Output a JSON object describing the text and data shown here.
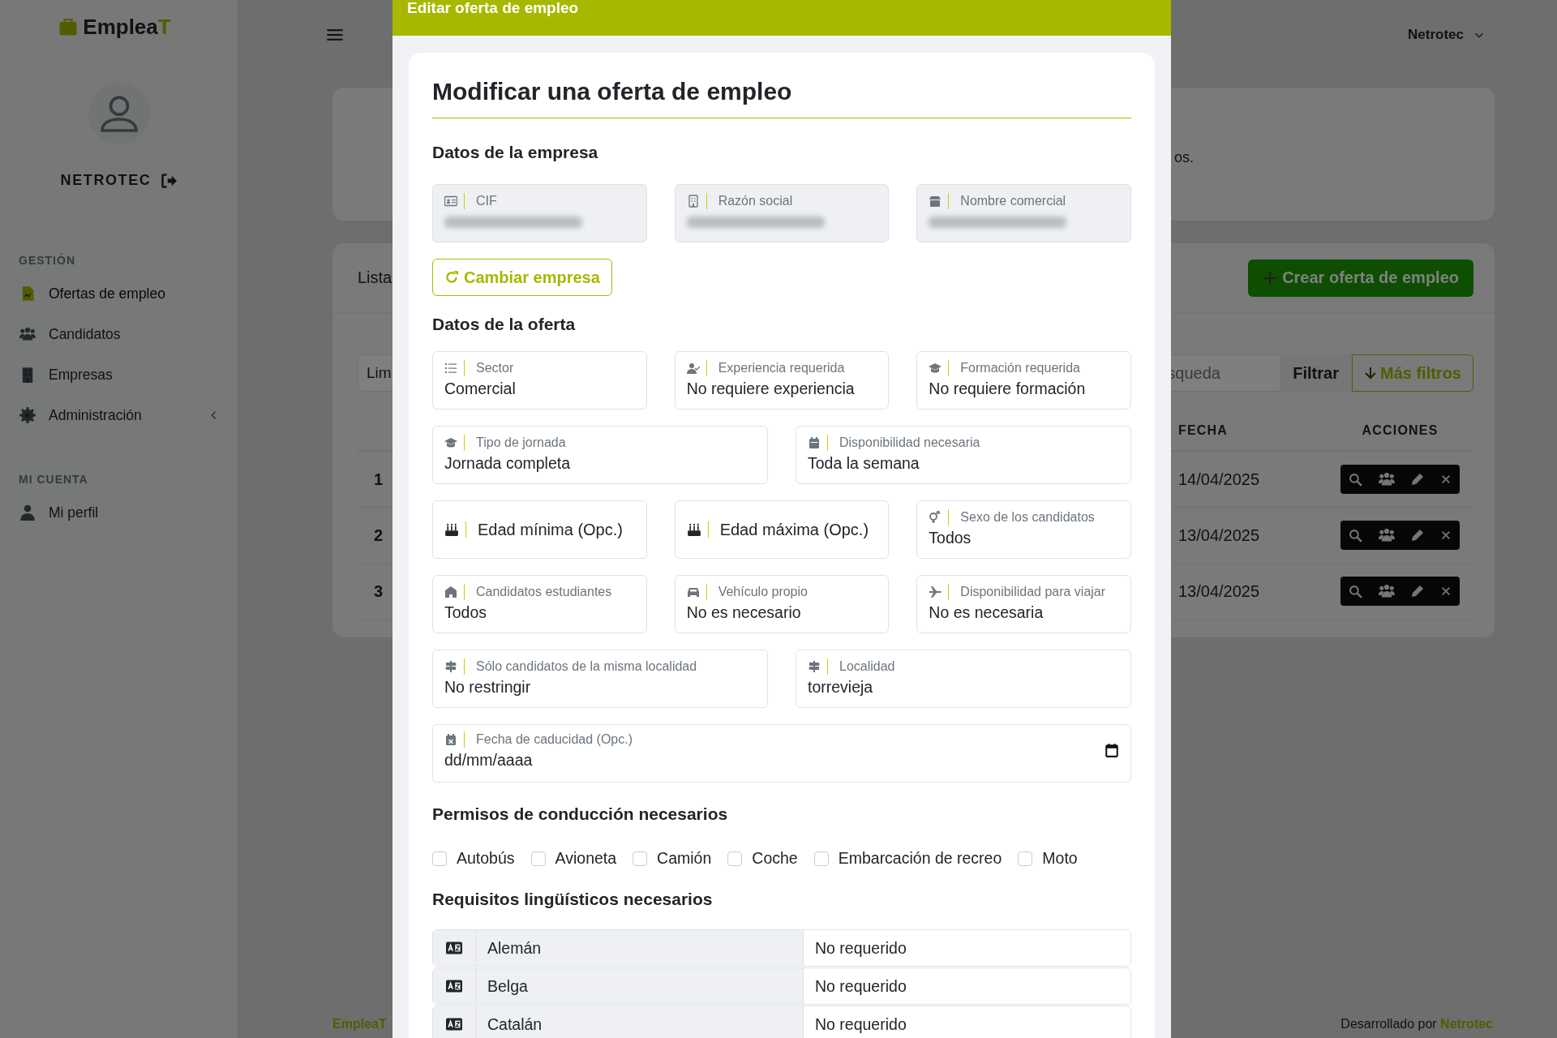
{
  "sidebar": {
    "logo": {
      "text": "Emplea",
      "accent": "T"
    },
    "user": "NETROTEC",
    "sections": [
      {
        "title": "GESTIÓN",
        "items": [
          {
            "label": "Ofertas de empleo",
            "selected": true,
            "expandable": false
          },
          {
            "label": "Candidatos",
            "selected": false,
            "expandable": false
          },
          {
            "label": "Empresas",
            "selected": false,
            "expandable": false
          },
          {
            "label": "Administración",
            "selected": false,
            "expandable": true
          }
        ]
      },
      {
        "title": "MI CUENTA",
        "items": [
          {
            "label": "Mi perfil",
            "selected": false,
            "expandable": false
          }
        ]
      }
    ]
  },
  "topbar": {
    "user": "Netrotec"
  },
  "intro_card": {
    "text": "os."
  },
  "offers": {
    "title": "Lista",
    "create_button": "Crear oferta de empleo",
    "filter_field": "Lim",
    "search_placeholder": "squeda",
    "filter_button": "Filtrar",
    "more_filters_button": "Más filtros",
    "columns": [
      "FECHA",
      "ACCIONES"
    ],
    "rows": [
      {
        "number": "1",
        "date": "14/04/2025"
      },
      {
        "number": "2",
        "date": "13/04/2025"
      },
      {
        "number": "3",
        "date": "13/04/2025"
      }
    ]
  },
  "footer": {
    "brand": "EmpleaT",
    "credit": "Desarrollado por",
    "credit_link": "Netrotec"
  },
  "modal": {
    "title": "Editar oferta de empleo",
    "heading": "Modificar una oferta de empleo",
    "company": {
      "title": "Datos de la empresa",
      "fields": [
        {
          "label": "CIF",
          "kind": "readonly"
        },
        {
          "label": "Razón social",
          "kind": "readonly"
        },
        {
          "label": "Nombre comercial",
          "kind": "readonly"
        }
      ],
      "change_button": "Cambiar empresa"
    },
    "offer": {
      "title": "Datos de la oferta",
      "rows": [
        [
          {
            "kind": "select",
            "label": "Sector",
            "value": "Comercial"
          },
          {
            "kind": "select",
            "label": "Experiencia requerida",
            "value": "No requiere experiencia"
          },
          {
            "kind": "select",
            "label": "Formación requerida",
            "value": "No requiere formación"
          }
        ],
        [
          {
            "kind": "select",
            "label": "Tipo de jornada",
            "value": "Jornada completa"
          },
          {
            "kind": "select",
            "label": "Disponibilidad necesaria",
            "value": "Toda la semana"
          }
        ],
        [
          {
            "kind": "number",
            "label": "Edad mínima (Opc.)"
          },
          {
            "kind": "number",
            "label": "Edad máxima (Opc.)"
          },
          {
            "kind": "select",
            "label": "Sexo de los candidatos",
            "value": "Todos"
          }
        ],
        [
          {
            "kind": "select",
            "label": "Candidatos estudiantes",
            "value": "Todos"
          },
          {
            "kind": "select",
            "label": "Vehículo propio",
            "value": "No es necesario"
          },
          {
            "kind": "select",
            "label": "Disponibilidad para viajar",
            "value": "No es necesaria"
          }
        ],
        [
          {
            "kind": "select",
            "label": "Sólo candidatos de la misma localidad",
            "value": "No restringir"
          },
          {
            "kind": "text",
            "label": "Localidad",
            "value": "torrevieja"
          }
        ],
        [
          {
            "kind": "date",
            "label": "Fecha de caducidad (Opc.)",
            "placeholder": "dd/mm/aaaa"
          }
        ]
      ]
    },
    "licenses": {
      "title": "Permisos de conducción necesarios",
      "options": [
        {
          "label": "Autobús",
          "checked": false
        },
        {
          "label": "Avioneta",
          "checked": false
        },
        {
          "label": "Camión",
          "checked": false
        },
        {
          "label": "Coche",
          "checked": false
        },
        {
          "label": "Embarcación de recreo",
          "checked": false
        },
        {
          "label": "Moto",
          "checked": false
        }
      ]
    },
    "languages": {
      "title": "Requisitos lingüísticos necesarios",
      "rows": [
        {
          "language": "Alemán",
          "requirement": "No requerido"
        },
        {
          "language": "Belga",
          "requirement": "No requerido"
        },
        {
          "language": "Catalán",
          "requirement": "No requerido"
        }
      ]
    }
  }
}
